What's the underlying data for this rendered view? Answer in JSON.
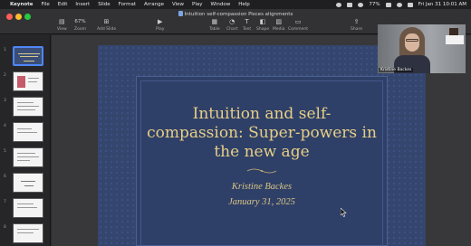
{
  "menubar": {
    "apple": "",
    "app": "Keynote",
    "menus": [
      "File",
      "Edit",
      "Insert",
      "Slide",
      "Format",
      "Arrange",
      "View",
      "Play",
      "Window",
      "Help"
    ],
    "battery": "77%",
    "datetime": "Fri Jan 31  10:01 AM"
  },
  "window": {
    "title": "Intuition self-compassion Pisces alignments",
    "toolbar": {
      "view": "View",
      "zoom_value": "67%",
      "zoom": "Zoom",
      "add_slide": "Add Slide",
      "play": "Play",
      "table": "Table",
      "chart": "Chart",
      "text": "Text",
      "shape": "Shape",
      "media": "Media",
      "comment": "Comment",
      "share": "Share"
    },
    "colors": {
      "close": "#ff5f57",
      "minimize": "#febc2e",
      "zoom": "#28c840",
      "accent": "#4f86f7"
    }
  },
  "navigator": {
    "slide_numbers": [
      "1",
      "2",
      "3",
      "4",
      "5",
      "6",
      "7",
      "8"
    ]
  },
  "slide": {
    "title_lines": [
      "Intuition and self-",
      "compassion: Super-powers in",
      "the new age"
    ],
    "author": "Kristine Backes",
    "date": "January 31, 2025"
  },
  "video": {
    "participant_name": "Kristine Backes"
  }
}
